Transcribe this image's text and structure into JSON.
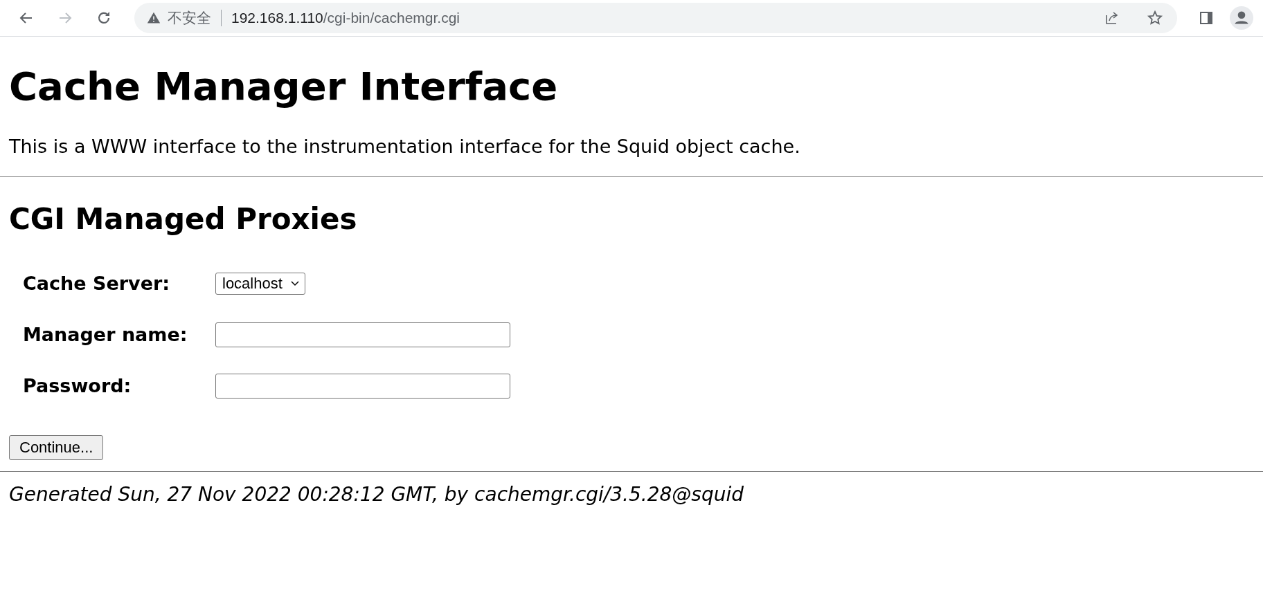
{
  "browser": {
    "security_label": "不安全",
    "url_host": "192.168.1.110",
    "url_path": "/cgi-bin/cachemgr.cgi"
  },
  "page": {
    "title": "Cache Manager Interface",
    "intro": "This is a WWW interface to the instrumentation interface for the Squid object cache.",
    "section_title": "CGI Managed Proxies",
    "fields": [
      {
        "kind": "select",
        "label": "Cache Server:",
        "value": "localhost"
      },
      {
        "kind": "text",
        "label": "Manager name:"
      },
      {
        "kind": "password",
        "label": "Password:"
      }
    ],
    "button": "Continue...",
    "footer": "Generated Sun, 27 Nov 2022 00:28:12 GMT, by cachemgr.cgi/3.5.28@squid"
  }
}
